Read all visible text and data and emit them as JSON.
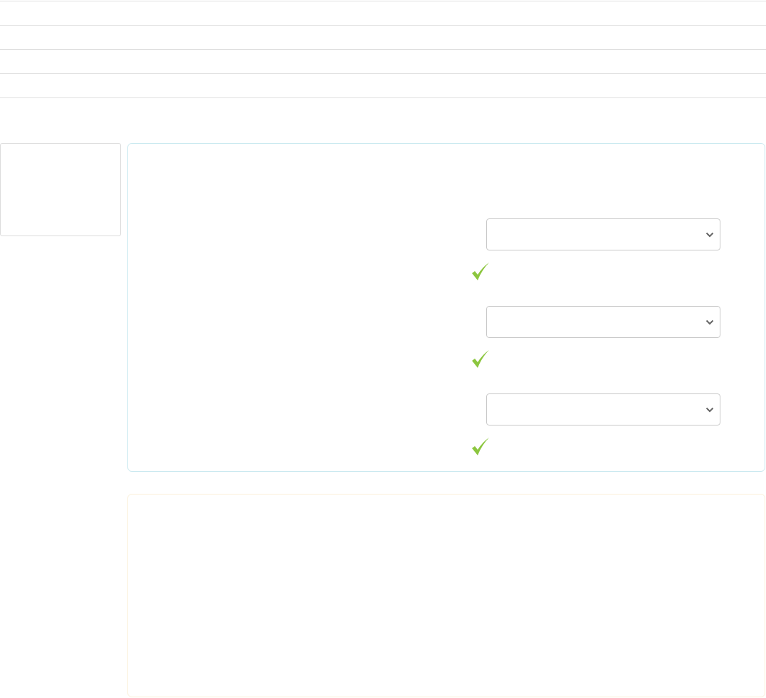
{
  "selects": [
    {
      "valid": true
    },
    {
      "valid": true
    },
    {
      "valid": true
    }
  ]
}
